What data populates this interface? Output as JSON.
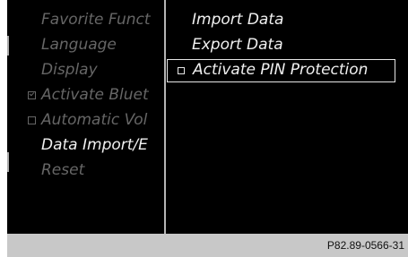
{
  "left_menu": {
    "items": [
      {
        "label": "Favorite Funct",
        "state": "dim"
      },
      {
        "label": "Language",
        "state": "dim"
      },
      {
        "label": "Display",
        "state": "dim"
      },
      {
        "label": "Activate Bluet",
        "state": "dim",
        "checkbox": "checked"
      },
      {
        "label": "Automatic Vol",
        "state": "dim",
        "checkbox": "unchecked"
      },
      {
        "label": "Data Import/E",
        "state": "active"
      },
      {
        "label": "Reset",
        "state": "dim"
      }
    ]
  },
  "right_menu": {
    "items": [
      {
        "label": "Import Data"
      },
      {
        "label": "Export Data"
      },
      {
        "label": "Activate PIN Protection",
        "selected": true,
        "checkbox": "unchecked"
      }
    ]
  },
  "footer": {
    "code": "P82.89-0566-31"
  },
  "colors": {
    "screen_bg": "#000000",
    "text_active": "#f0f0f0",
    "text_dim": "#666666",
    "footer_bg": "#c8c8c8",
    "divider": "#b5b5b5"
  }
}
